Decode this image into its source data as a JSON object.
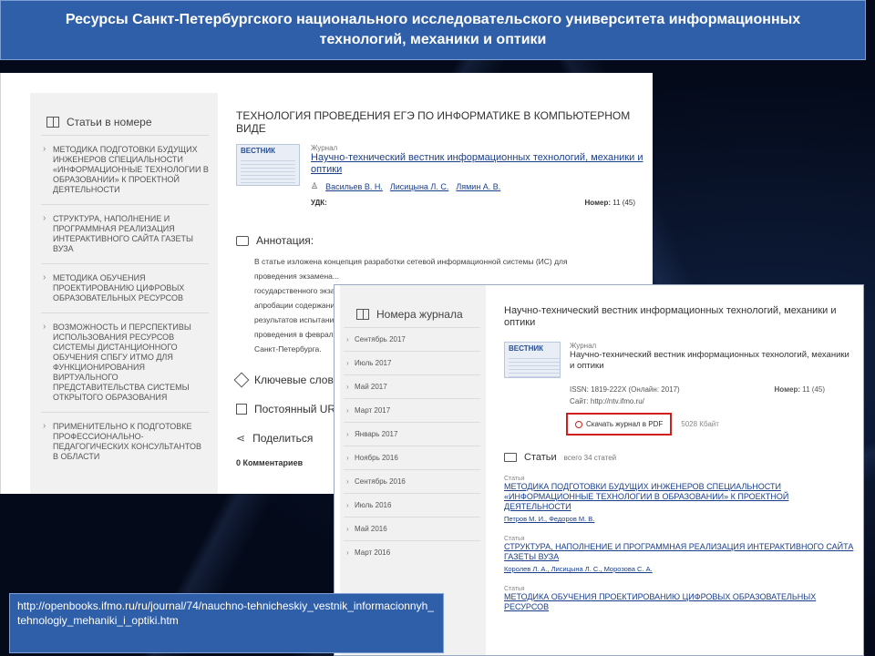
{
  "banner": {
    "title": "Ресурсы Санкт-Петербургского национального исследовательского университета информационных технологий, механики и оптики"
  },
  "back_page": {
    "sidebar_heading": "Статьи в номере",
    "sidebar_items": [
      "Методика подготовки будущих инженеров специальности «Информационные технологии в образовании» к проектной деятельности",
      "Структура, наполнение и программная реализация интерактивного сайта газеты вуза",
      "Методика обучения проектированию цифровых образовательных ресурсов",
      "Возможность и перспективы использования ресурсов системы дистанционного обучения СПбГУ ИТМО для функционирования виртуального представительства системы открытого образования",
      "Применительно к подготовке профессионально-педагогических консультантов в области"
    ],
    "article_title": "Технология проведения ЕГЭ по информатике в компьютерном виде",
    "cover_word": "ВЕСТНИК",
    "journal_label": "Журнал",
    "journal_name": "Научно-технический вестник информационных технологий, механики и оптики",
    "authors": [
      "Васильев В. Н.",
      "Лисицына Л. С.",
      "Лямин А. В."
    ],
    "udk_label": "УДК:",
    "issue_label": "Номер:",
    "issue_value": "11 (45)",
    "annotation_heading": "Аннотация:",
    "annotation_lines": [
      "В статье изложена концепция разработки сетевой информационной системы (ИС) для",
      "проведения экзамена...",
      "государственного экзамена...",
      "апробации содержания...",
      "результатов испытаний...",
      "проведения в феврале...",
      "Санкт-Петербурга."
    ],
    "keywords_label": "Ключевые слова",
    "permalink_label": "Постоянный URL",
    "share_label": "Поделиться",
    "comments_label": "0 Комментариев"
  },
  "front_page": {
    "sidebar_heading": "Номера журнала",
    "issues": [
      "Сентябрь 2017",
      "Июль 2017",
      "Май 2017",
      "Март 2017",
      "Январь 2017",
      "Ноябрь 2016",
      "Сентябрь 2016",
      "Июль 2016",
      "Май 2016",
      "Март 2016"
    ],
    "title": "Научно-технический вестник информационных технологий, механики и оптики",
    "journal_label": "Журнал",
    "journal_name": "Научно-технический вестник информационных технологий, механики и оптики",
    "issn_label": "ISSN:",
    "issn_value": "1819-222X (Онлайн: 2017)",
    "issue_label": "Номер:",
    "issue_value": "11 (45)",
    "site_label": "Сайт:",
    "site_value": "http://ntv.ifmo.ru/",
    "download_label": "Скачать журнал в PDF",
    "download_size": "5028 Кбайт",
    "articles_heading": "Статьи",
    "articles_count": "всего 34 статей",
    "article_label": "Статья",
    "articles": [
      {
        "title": "Методика подготовки будущих инженеров специальности «Информационные технологии в образовании» к проектной деятельности",
        "authors": "Петров М. И., Федоров М. В."
      },
      {
        "title": "Структура, наполнение и программная реализация интерактивного сайта газеты вуза",
        "authors": "Королев Л. А., Лисицына Л. С., Морозова С. А."
      },
      {
        "title": "Методика обучения проектированию цифровых образовательных ресурсов",
        "authors": ""
      }
    ]
  },
  "url_box": {
    "text": "http://openbooks.ifmo.ru/ru/journal/74/nauchno-tehnicheskiy_vestnik_informacionnyh_tehnologiy_mehaniki_i_optiki.htm"
  }
}
